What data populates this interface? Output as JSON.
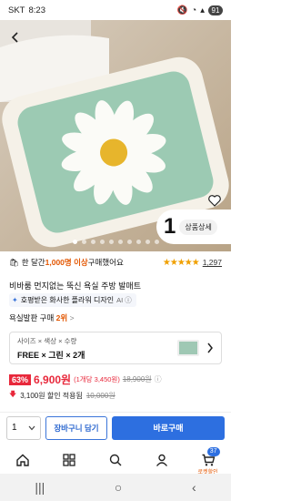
{
  "status": {
    "carrier": "SKT",
    "time": "8:23",
    "battery": "91"
  },
  "hero": {
    "counter_big": "1",
    "counter_detail": "상품상세",
    "dots": 10,
    "active_dot": 0
  },
  "promo": {
    "text_prefix": "한 달간 ",
    "highlight": "1,000명 이상",
    "text_suffix": " 구매했어요",
    "rating": 4.5,
    "review_count": "1,297"
  },
  "product": {
    "title": "비바룸 먼지없는 뚝신 욕실 주방 발매트",
    "ai_summary": "호평받은 화사한 플라워 디자인",
    "ai_label": "AI ⓘ",
    "rank_prefix": "욕실발판 구매 ",
    "rank_value": "2위",
    "rank_chevron": ">"
  },
  "option": {
    "keys": "사이즈 × 색상 × 수량",
    "values": "FREE × 그린 × 2개"
  },
  "price": {
    "discount": "63%",
    "price": "6,900원",
    "unit": "(1개당 3,450원)",
    "original": "18,900원",
    "coupon_prefix": "3,100원 할인 적용됨",
    "coupon_original": "10,000원"
  },
  "actions": {
    "qty": "1",
    "cart": "장바구니 담기",
    "buy": "바로구매"
  },
  "tabbar": {
    "cart_badge": "37",
    "cart_sub": "로켓할인"
  }
}
